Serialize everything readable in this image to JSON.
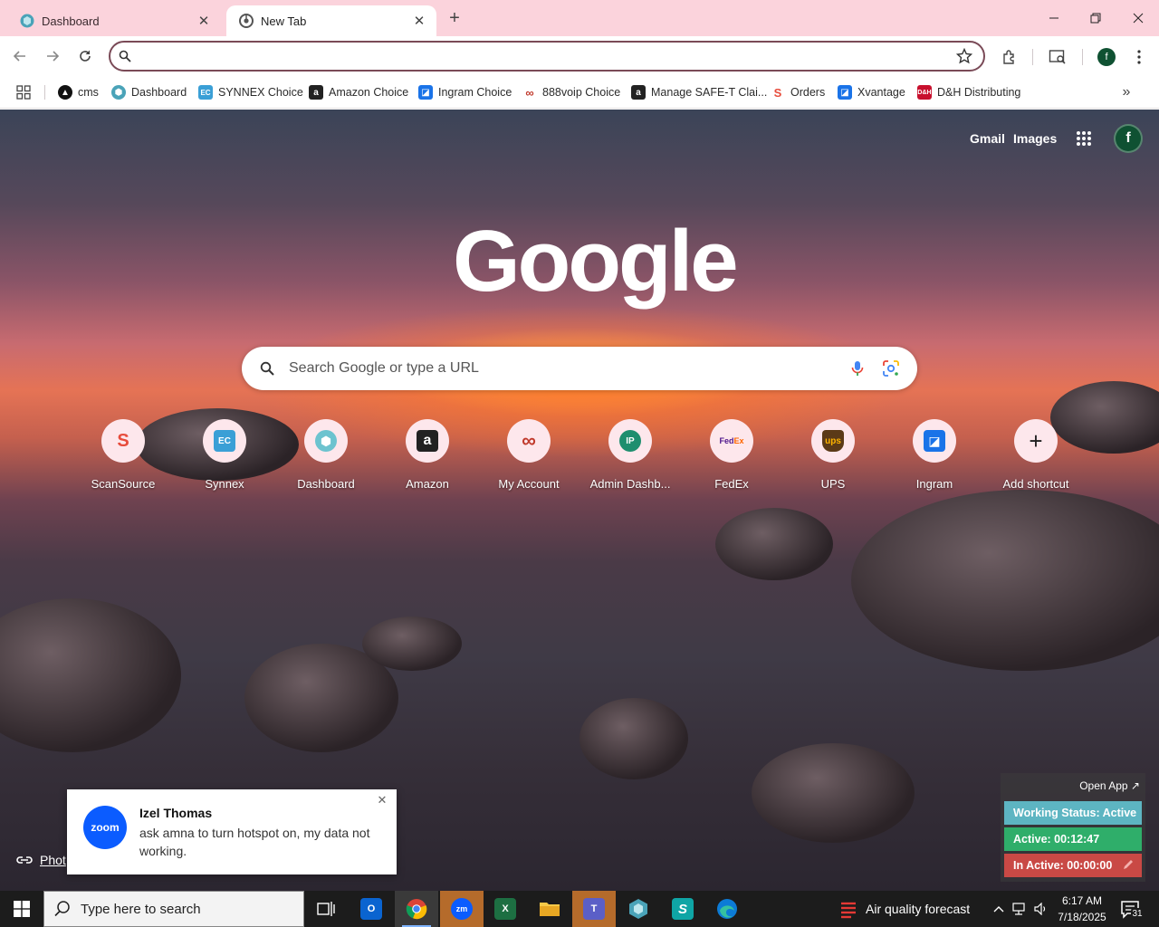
{
  "tabs": [
    {
      "title": "Dashboard",
      "active": false
    },
    {
      "title": "New Tab",
      "active": true
    }
  ],
  "omnibox": {
    "value": "",
    "placeholder": ""
  },
  "bookmarks": [
    {
      "label": "cms",
      "icon": "cms-icon",
      "color": "#111111"
    },
    {
      "label": "Dashboard",
      "icon": "hexagon-icon",
      "color": "#4aa3b8"
    },
    {
      "label": "SYNNEX Choice",
      "icon": "ec-icon",
      "color": "#3a9fd6"
    },
    {
      "label": "Amazon Choice",
      "icon": "amazon-icon",
      "color": "#222222"
    },
    {
      "label": "Ingram Choice",
      "icon": "ingram-icon",
      "color": "#1a73e8"
    },
    {
      "label": "888voip Choice",
      "icon": "888voip-icon",
      "color": "#c0392b"
    },
    {
      "label": "Manage SAFE-T Clai...",
      "icon": "amazon-icon",
      "color": "#222222"
    },
    {
      "label": "Orders",
      "icon": "scansource-icon",
      "color": "#e74c3c"
    },
    {
      "label": "Xvantage",
      "icon": "ingram-icon",
      "color": "#1a73e8"
    },
    {
      "label": "D&H Distributing",
      "icon": "dh-icon",
      "color": "#c8102e"
    }
  ],
  "ntp": {
    "gmail": "Gmail",
    "images": "Images",
    "avatar_letter": "f",
    "logo": "Google",
    "search_placeholder": "Search Google or type a URL",
    "photo_link": "Phot"
  },
  "shortcuts": [
    {
      "label": "ScanSource",
      "icon": "scansource-icon",
      "color": "#e74c3c",
      "glyph": "S"
    },
    {
      "label": "Synnex",
      "icon": "ec-icon",
      "color": "#3a9fd6",
      "glyph": "EC"
    },
    {
      "label": "Dashboard",
      "icon": "hexagon-icon",
      "color": "#6cc3cf",
      "glyph": "⬢"
    },
    {
      "label": "Amazon",
      "icon": "amazon-icon",
      "color": "#222222",
      "glyph": "a"
    },
    {
      "label": "My Account",
      "icon": "888voip-icon",
      "color": "#c0392b",
      "glyph": "∞"
    },
    {
      "label": "Admin Dashb...",
      "icon": "ip-icon",
      "color": "#1e8e6e",
      "glyph": "IP"
    },
    {
      "label": "FedEx",
      "icon": "fedex-icon",
      "color": "#4d148c",
      "glyph": "FedEx"
    },
    {
      "label": "UPS",
      "icon": "ups-icon",
      "color": "#5b3a17",
      "glyph": "ups"
    },
    {
      "label": "Ingram",
      "icon": "ingram-icon",
      "color": "#1a73e8",
      "glyph": "◪"
    },
    {
      "label": "Add shortcut",
      "icon": "plus-icon",
      "color": "#1f1f1f",
      "glyph": "+"
    }
  ],
  "toast": {
    "sender": "Izel Thomas",
    "message": "ask amna to turn hotspot on, my data not working.",
    "app": "zoom"
  },
  "tracker": {
    "open_app": "Open App ↗",
    "working_status": "Working Status: Active",
    "active": "Active: 00:12:47",
    "inactive": "In Active: 00:00:00"
  },
  "taskbar": {
    "search_placeholder": "Type here to search",
    "air_quality": "Air quality forecast",
    "time": "6:17 AM",
    "date": "7/18/2025",
    "notification_count": "31"
  }
}
